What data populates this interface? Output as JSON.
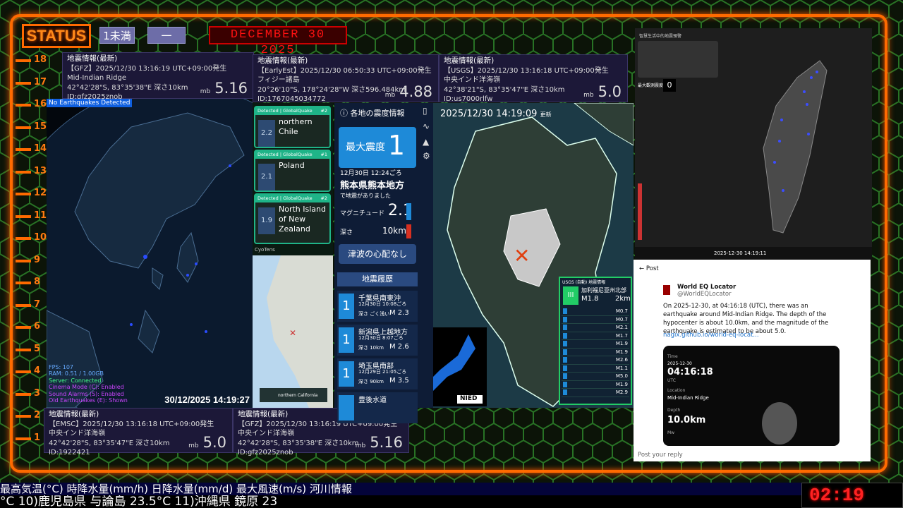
{
  "status": {
    "label": "STATUS",
    "level_label": "1未満",
    "level_value": "一",
    "date": "DECEMBER 30 2025"
  },
  "ruler": {
    "numbers": [
      "18",
      "17",
      "16",
      "15",
      "14",
      "13",
      "12",
      "11",
      "10",
      "9",
      "8",
      "7",
      "6",
      "5",
      "4",
      "3",
      "2",
      "1"
    ]
  },
  "cards": {
    "gfz1": {
      "hd": "地震情報(最新)",
      "l1": "【GFZ】2025/12/30 13:16:19 UTC+09:00発生",
      "l2": "Mid-Indian Ridge",
      "l3": "42°42'28\"S, 83°35'38\"E 深さ10km",
      "l4": "ID:gfz2025znob",
      "mb": "mb",
      "mag": "5.16"
    },
    "early": {
      "hd": "地震情報(最新)",
      "l1": "【EarlyEst】2025/12/30 06:50:33 UTC+09:00発生",
      "l2": "フィジー諸島",
      "l3": "20°26'10\"S, 178°24'28\"W 深さ596.484km",
      "l4": "ID:1767045034772",
      "mb": "mb",
      "mag": "4.88"
    },
    "usgs": {
      "hd": "地震情報(最新)",
      "l1": "【USGS】2025/12/30 13:16:18 UTC+09:00発生",
      "l2": "中央インド洋海嶺",
      "l3": "42°38'21\"S, 83°35'47\"E 深さ10km",
      "l4": "ID:us7000rlfw",
      "mb": "mb",
      "mag": "5.0"
    },
    "emsc": {
      "hd": "地震情報(最新)",
      "l1": "【EMSC】2025/12/30 13:16:18 UTC+09:00発生",
      "l2": "中央インド洋海嶺",
      "l3": "42°42'28\"S, 83°35'47\"E 深さ10km",
      "l4": "ID:1922421",
      "mb": "mb",
      "mag": "5.0"
    },
    "gfz2": {
      "hd": "地震情報(最新)",
      "l1": "【GFZ】2025/12/30 13:16:19 UTC+09:00発生",
      "l2": "中央インド洋海嶺",
      "l3": "42°42'28\"S, 83°35'38\"E 深さ10km",
      "l4": "ID:gfz2025znob",
      "mb": "mb",
      "mag": "5.16"
    }
  },
  "globe": {
    "banner": "No Earthquakes Detected",
    "stats": [
      "FPS: 107",
      "RAM: 0.51 / 1.00GB",
      "Server: Connected",
      "Cinema Mode (C): Enabled",
      "Sound Alarms (S): Enabled",
      "Old Earthquakes (E): Shown"
    ],
    "time": "30/12/2025 14:19:27"
  },
  "globalquake": [
    {
      "tag": "Detected | GlobalQuake",
      "idx": "#2",
      "place": "northern Chile",
      "mag": "2.2",
      "sub": "12/30/2025 4:58:38 AM (UTC)",
      "sub2": "Depth 95.7km Quality C"
    },
    {
      "tag": "Detected | GlobalQuake",
      "idx": "#1",
      "place": "Poland",
      "mag": "2.1",
      "sub": "12/30/2025 4:47:51 AM (UTC)",
      "sub2": "Depth 5.0km Quality D"
    },
    {
      "tag": "Detected | GlobalQuake",
      "idx": "#2",
      "place": "North Island of New Zealand",
      "mag": "1.9",
      "sub": "12/30/2025 4:39:05 AM (UTC)",
      "sub2": "Depth 20.0km Quality A"
    }
  ],
  "gq_footer": "CyoTens",
  "gq_mini": "northern California",
  "jp": {
    "title": "各地の震度情報",
    "max_label": "最大震度",
    "max_value": "1",
    "date": "12月30日 12:24ごろ",
    "region": "熊本県熊本地方",
    "occurred": "で地震がありました",
    "mag_label": "マグニチュード",
    "mag": "2.1",
    "depth_label": "深さ",
    "depth": "10km",
    "tsunami": "津波の心配なし",
    "history_title": "地震履歴",
    "history": [
      {
        "int": "1",
        "region": "千葉県南東沖",
        "date": "12月30日 10:08ごろ",
        "depth": "深さ ごく浅い",
        "mag": "M 2.3"
      },
      {
        "int": "1",
        "region": "新潟県上越地方",
        "date": "12月30日 8:07ごろ",
        "depth": "深さ 10km",
        "mag": "M 2.6"
      },
      {
        "int": "1",
        "region": "埼玉県南部",
        "date": "12月29日 21:05ごろ",
        "depth": "深さ 90km",
        "mag": "M 3.5"
      },
      {
        "int": "",
        "region": "豊後水道",
        "date": "",
        "depth": "",
        "mag": ""
      }
    ]
  },
  "kyushu": {
    "time": "2025/12/30 14:19:09",
    "update": "更新",
    "usgs_hd": "USGS (自動) 地震情報",
    "usgs_region": "加利福尼亚州北部",
    "usgs_mag": "M1.8",
    "usgs_depth": "2km",
    "usgs_int": "III",
    "list": [
      "M0.7",
      "M0.7",
      "M2.1",
      "M1.7",
      "M1.9",
      "M1.9",
      "M2.6",
      "M1.1",
      "M5.0",
      "M1.9",
      "M2.9"
    ],
    "nied": "NIED"
  },
  "taiwan": {
    "title": "智慧生活中的地震預警",
    "pga_label": "最大觀測震度",
    "pga": "0",
    "time": "2025-12-30 14:19:11"
  },
  "post": {
    "back": "Post",
    "name": "World EQ Locator",
    "handle": "@WorldEQLocator",
    "text": "On 2025-12-30, at 04:16:18 (UTC), there was an earthquake around Mid-Indian Ridge. The depth of the hypocenter is about 10.0km, and the magnitude of the earthquake is estimated to be about 5.0.",
    "link": "nagix.github.io/world-eq-locat...",
    "card_time_label": "Time",
    "card_date": "2025-12-30",
    "card_time": "04:16:18",
    "card_utc": "UTC",
    "card_loc_label": "Location",
    "card_loc": "Mid-Indian Ridge",
    "card_depth_label": "Depth",
    "card_depth": "10.0km",
    "card_mag_label": "Mw",
    "reply": "Post your reply"
  },
  "ticker": {
    "line1": "最高気温(°C) 時降水量(mm/h) 日降水量(mm/d) 最大風速(m/s) 河川情報",
    "line2": "°C    10)鹿児島県 与論島 23.5°C    11)沖縄県 鏡原 23",
    "clock": "02:19"
  }
}
